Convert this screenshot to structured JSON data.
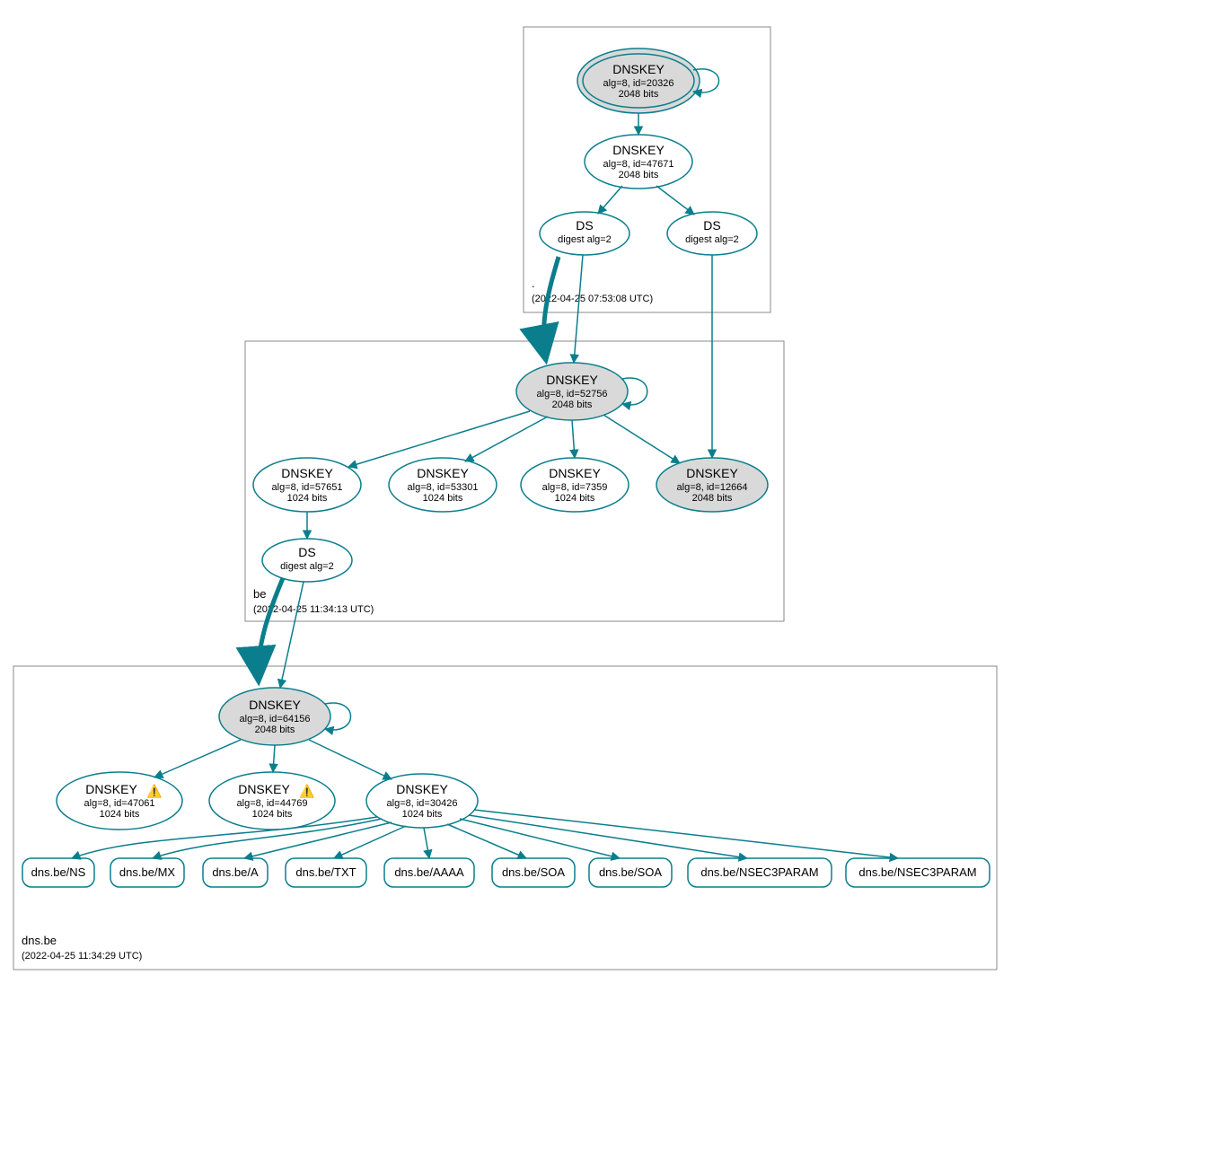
{
  "colors": {
    "stroke": "#0a7e8c",
    "fillKey": "#d9d9d9",
    "fillPlain": "#ffffff",
    "zoneBorder": "#888888"
  },
  "zones": {
    "root": {
      "label": ".",
      "timestamp": "(2022-04-25 07:53:08 UTC)"
    },
    "be": {
      "label": "be",
      "timestamp": "(2022-04-25 11:34:13 UTC)"
    },
    "dnsbe": {
      "label": "dns.be",
      "timestamp": "(2022-04-25 11:34:29 UTC)"
    }
  },
  "nodes": {
    "root_ksk": {
      "title": "DNSKEY",
      "line1": "alg=8, id=20326",
      "line2": "2048 bits"
    },
    "root_zsk": {
      "title": "DNSKEY",
      "line1": "alg=8, id=47671",
      "line2": "2048 bits"
    },
    "root_ds1": {
      "title": "DS",
      "line1": "digest alg=2"
    },
    "root_ds2": {
      "title": "DS",
      "line1": "digest alg=2"
    },
    "be_ksk": {
      "title": "DNSKEY",
      "line1": "alg=8, id=52756",
      "line2": "2048 bits"
    },
    "be_zsk1": {
      "title": "DNSKEY",
      "line1": "alg=8, id=57651",
      "line2": "1024 bits"
    },
    "be_zsk2": {
      "title": "DNSKEY",
      "line1": "alg=8, id=53301",
      "line2": "1024 bits"
    },
    "be_zsk3": {
      "title": "DNSKEY",
      "line1": "alg=8, id=7359",
      "line2": "1024 bits"
    },
    "be_key2": {
      "title": "DNSKEY",
      "line1": "alg=8, id=12664",
      "line2": "2048 bits"
    },
    "be_ds": {
      "title": "DS",
      "line1": "digest alg=2"
    },
    "dnsbe_ksk": {
      "title": "DNSKEY",
      "line1": "alg=8, id=64156",
      "line2": "2048 bits"
    },
    "dnsbe_z1": {
      "title": "DNSKEY",
      "line1": "alg=8, id=47061",
      "line2": "1024 bits",
      "warn": true
    },
    "dnsbe_z2": {
      "title": "DNSKEY",
      "line1": "alg=8, id=44769",
      "line2": "1024 bits",
      "warn": true
    },
    "dnsbe_z3": {
      "title": "DNSKEY",
      "line1": "alg=8, id=30426",
      "line2": "1024 bits"
    }
  },
  "rr": {
    "ns": "dns.be/NS",
    "mx": "dns.be/MX",
    "a": "dns.be/A",
    "txt": "dns.be/TXT",
    "aaaa": "dns.be/AAAA",
    "soa1": "dns.be/SOA",
    "soa2": "dns.be/SOA",
    "n3p1": "dns.be/NSEC3PARAM",
    "n3p2": "dns.be/NSEC3PARAM"
  },
  "warnGlyph": "⚠️"
}
